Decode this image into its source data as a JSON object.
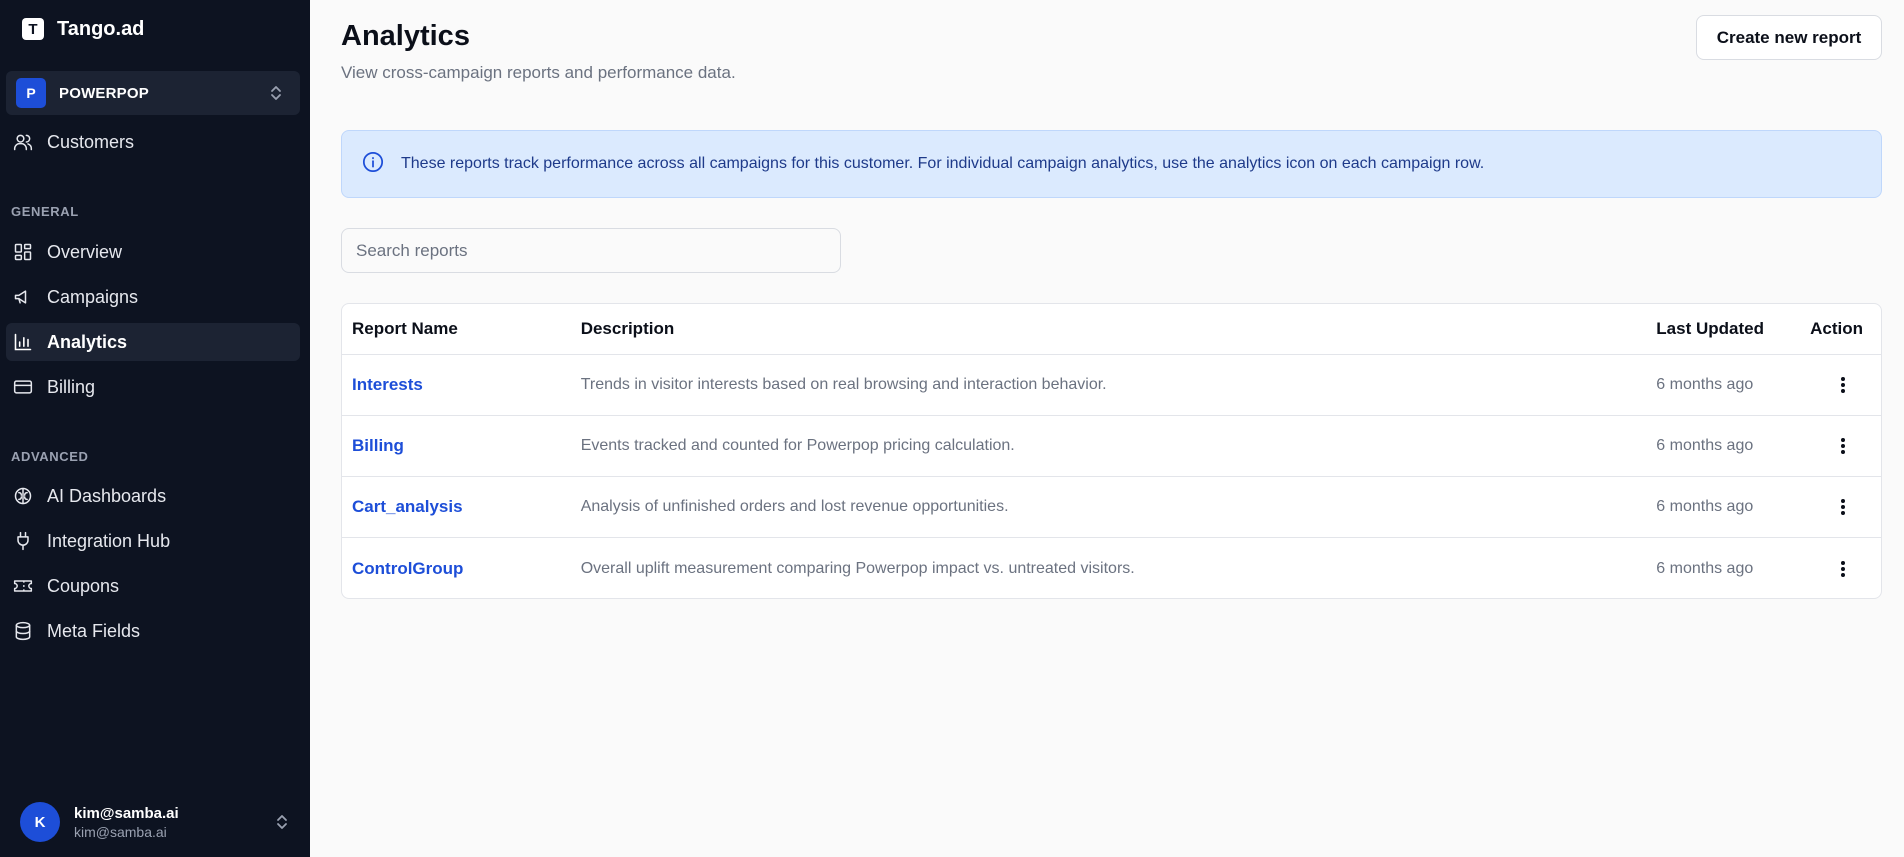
{
  "app": {
    "name": "Tango.ad",
    "logo_letter": "T"
  },
  "org": {
    "badge": "P",
    "name": "POWERPOP"
  },
  "sidebar": {
    "top_items": [
      {
        "label": "Customers",
        "icon": "users-icon"
      }
    ],
    "general_label": "GENERAL",
    "general_items": [
      {
        "label": "Overview",
        "icon": "grid-icon"
      },
      {
        "label": "Campaigns",
        "icon": "megaphone-icon"
      },
      {
        "label": "Analytics",
        "icon": "bar-chart-icon",
        "active": true
      },
      {
        "label": "Billing",
        "icon": "credit-card-icon"
      }
    ],
    "advanced_label": "ADVANCED",
    "advanced_items": [
      {
        "label": "AI Dashboards",
        "icon": "brain-icon"
      },
      {
        "label": "Integration Hub",
        "icon": "plug-icon"
      },
      {
        "label": "Coupons",
        "icon": "ticket-icon"
      },
      {
        "label": "Meta Fields",
        "icon": "database-icon"
      }
    ]
  },
  "user": {
    "initial": "K",
    "name": "kim@samba.ai",
    "email": "kim@samba.ai"
  },
  "page": {
    "title": "Analytics",
    "subtitle": "View cross-campaign reports and performance data.",
    "create_button": "Create new report"
  },
  "info": {
    "icon": "info-icon",
    "text": "These reports track performance across all campaigns for this customer. For individual campaign analytics, use the analytics icon on each campaign row."
  },
  "search": {
    "placeholder": "Search reports",
    "value": ""
  },
  "table": {
    "columns": [
      "Report Name",
      "Description",
      "Last Updated",
      "Action"
    ],
    "rows": [
      {
        "name": "Interests",
        "description": "Trends in visitor interests based on real browsing and interaction behavior.",
        "updated": "6 months ago"
      },
      {
        "name": "Billing",
        "description": "Events tracked and counted for Powerpop pricing calculation.",
        "updated": "6 months ago"
      },
      {
        "name": "Cart_analysis",
        "description": "Analysis of unfinished orders and lost revenue opportunities.",
        "updated": "6 months ago"
      },
      {
        "name": "ControlGroup",
        "description": "Overall uplift measurement comparing Powerpop impact vs. untreated visitors.",
        "updated": "6 months ago"
      }
    ]
  },
  "colors": {
    "sidebar_bg": "#0d1321",
    "accent": "#1d4ed8",
    "info_bg": "#dbeafe",
    "info_text": "#1e3a8a"
  }
}
